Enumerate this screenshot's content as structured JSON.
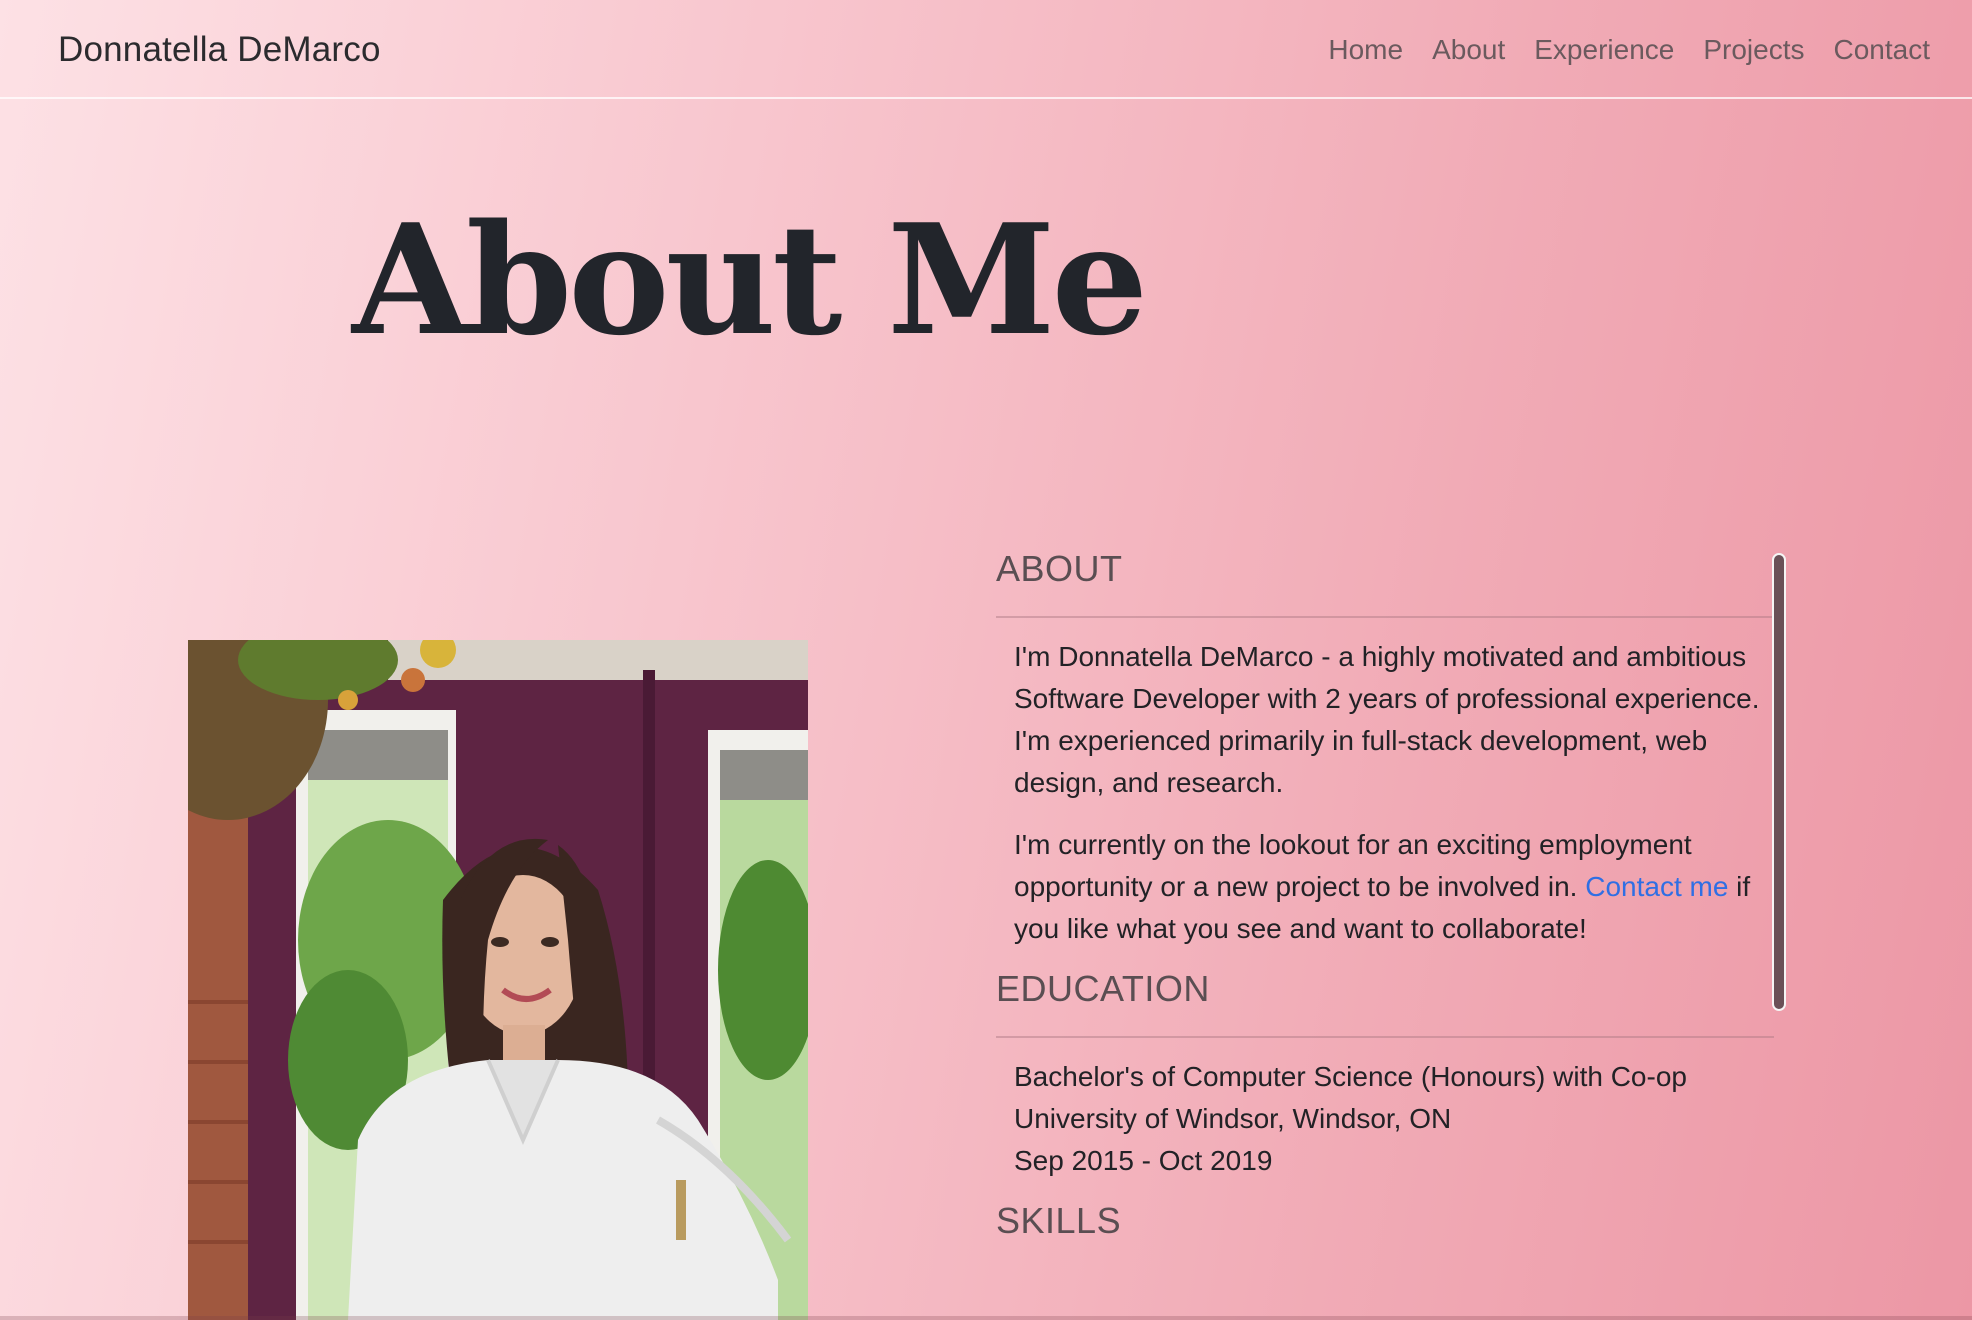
{
  "nav": {
    "brand": "Donnatella DeMarco",
    "links": [
      "Home",
      "About",
      "Experience",
      "Projects",
      "Contact"
    ]
  },
  "page": {
    "title": "About Me"
  },
  "about": {
    "heading": "ABOUT",
    "p1": "I'm Donnatella DeMarco - a highly motivated and ambitious Software Developer with 2 years of professional experience. I'm experienced primarily in full-stack development, web design, and research.",
    "p2_before": "I'm currently on the lookout for an exciting employment opportunity or a new project to be involved in. ",
    "p2_link": "Contact me",
    "p2_after": " if you like what you see and want to collaborate!"
  },
  "education": {
    "heading": "EDUCATION",
    "degree": "Bachelor's of Computer Science (Honours) with Co-op",
    "school": "University of Windsor, Windsor, ON",
    "dates": "Sep 2015 - Oct 2019"
  },
  "skills": {
    "heading": "SKILLS"
  },
  "colors": {
    "link": "#2f6fe4",
    "text": "#212529",
    "nav_text": "#6b5a5e"
  }
}
